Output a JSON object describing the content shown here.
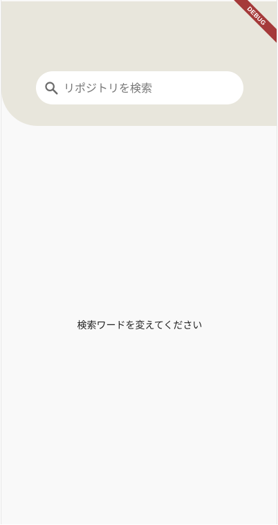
{
  "search": {
    "placeholder": "リポジトリを検索",
    "value": ""
  },
  "main": {
    "empty_message": "検索ワードを変えてください"
  },
  "debug_banner": {
    "label": "DEBUG"
  },
  "colors": {
    "header_bg": "#e8e6dc",
    "page_bg": "#f9f9f9",
    "search_bg": "#ffffff",
    "ribbon": "#a53a3a"
  },
  "icons": {
    "search": "search-icon"
  }
}
